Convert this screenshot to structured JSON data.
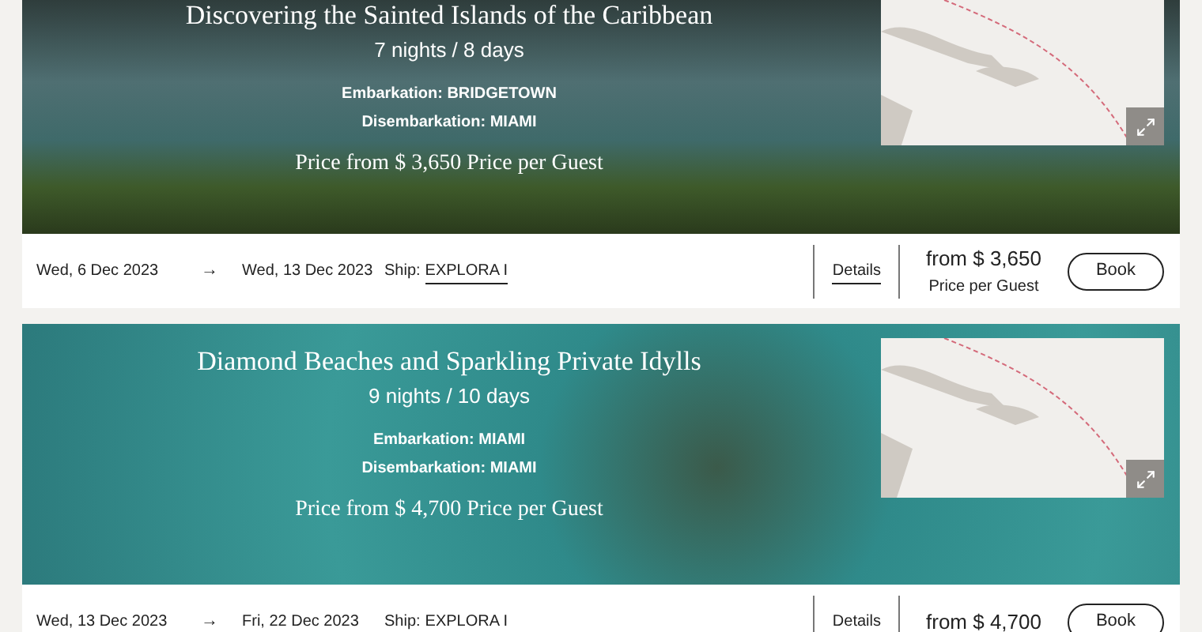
{
  "cruises": [
    {
      "title": "Discovering the Sainted Islands of the Caribbean",
      "duration": "7 nights / 8 days",
      "embarkation": "Embarkation: BRIDGETOWN",
      "disembarkation": "Disembarkation: MIAMI",
      "price_line": "Price from $ 3,650 Price per Guest",
      "kind": "harbour",
      "start_date": "Wed, 6 Dec 2023",
      "arrow": "→",
      "end_date": "Wed, 13 Dec 2023",
      "ship_label": "Ship:",
      "ship": "EXPLORA I",
      "details": "Details",
      "price": "from $ 3,650",
      "price_note": "Price per Guest",
      "book": "Book"
    },
    {
      "title": "Diamond Beaches and Sparkling Private Idylls",
      "duration": "9 nights / 10 days",
      "embarkation": "Embarkation: MIAMI",
      "disembarkation": "Disembarkation: MIAMI",
      "price_line": "Price from $ 4,700 Price per Guest",
      "kind": "reef",
      "start_date": "Wed, 13 Dec 2023",
      "arrow": "→",
      "end_date": "Fri, 22 Dec 2023",
      "ship_label": "Ship:",
      "ship": "EXPLORA I",
      "details": "Details",
      "price": "from $ 4,700",
      "book": "Book"
    }
  ]
}
